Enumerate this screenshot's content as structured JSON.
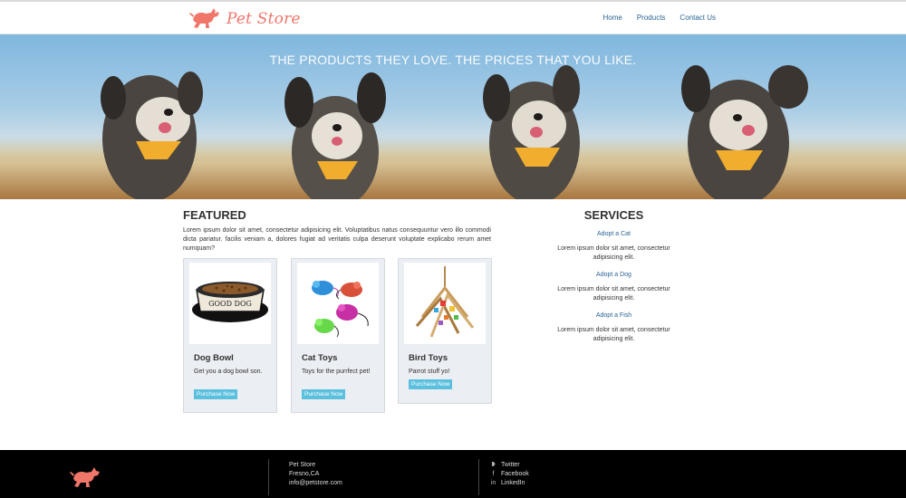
{
  "brand": {
    "name": "Pet Store",
    "logo_icon": "running-dog-icon",
    "accent": "#f0766a"
  },
  "nav": {
    "items": [
      {
        "label": "Home"
      },
      {
        "label": "Products"
      },
      {
        "label": "Contact Us"
      }
    ]
  },
  "hero": {
    "title": "THE PRODUCTS THEY LOVE. THE PRICES THAT YOU LIKE."
  },
  "featured": {
    "title": "FEATURED",
    "intro": "Lorem ipsum dolor sit amet, consectetur adipisicing elit. Voluptatibus natus consequuntur vero illo commodi dicta pariatur. facilis veniam a, dolores fugiat ad veritatis culpa deserunt voluptate explicabo rerum amet numquam?",
    "products": [
      {
        "name": "Dog Bowl",
        "description": "Get you a dog bowl son.",
        "button": "Purchase Now",
        "bowl_label": "GOOD DOG"
      },
      {
        "name": "Cat Toys",
        "description": "Toys for the purrfect pet!",
        "button": "Purchase Now"
      },
      {
        "name": "Bird Toys",
        "description": "Parrot stuff yo!",
        "button": "Purchase Now"
      }
    ]
  },
  "services": {
    "title": "SERVICES",
    "items": [
      {
        "link": "Adopt a Cat",
        "text": "Lorem ipsum dolor sit amet, consectetur adipisicing elit."
      },
      {
        "link": "Adopt a Dog",
        "text": "Lorem ipsum dolor sit amet, consectetur adipisicing elit."
      },
      {
        "link": "Adopt a Fish",
        "text": "Lorem ipsum dolor sit amet, consectetur adipisicing elit."
      }
    ]
  },
  "footer": {
    "address": {
      "name": "Pet Store",
      "city": "Fresno,CA",
      "email": "info@petstore.com"
    },
    "social": [
      {
        "label": "Twitter",
        "icon": "twitter-icon",
        "glyph": "❥"
      },
      {
        "label": "Facebook",
        "icon": "facebook-icon",
        "glyph": "f"
      },
      {
        "label": "LinkedIn",
        "icon": "linkedin-icon",
        "glyph": "in"
      }
    ]
  }
}
